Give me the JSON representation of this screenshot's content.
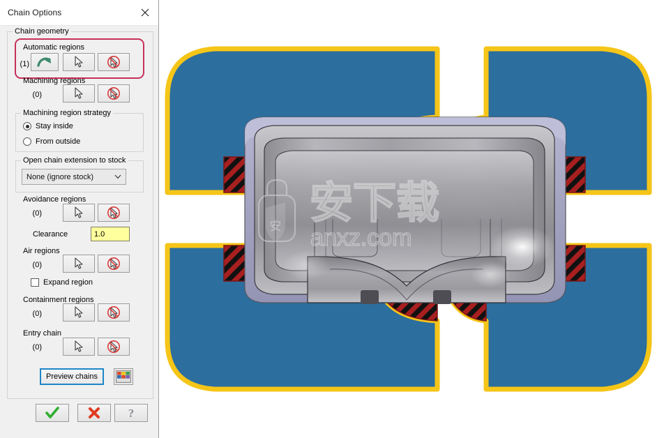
{
  "dialog": {
    "title": "Chain Options",
    "close_icon": "close-icon",
    "group_chain_geometry": "Chain geometry",
    "sections": {
      "automatic_regions": {
        "label": "Automatic regions",
        "count": "(1)"
      },
      "machining_regions": {
        "label": "Machining regions",
        "count": "(0)"
      },
      "avoidance_regions": {
        "label": "Avoidance regions",
        "count": "(0)"
      },
      "air_regions": {
        "label": "Air regions",
        "count": "(0)"
      },
      "containment_regions": {
        "label": "Containment regions",
        "count": "(0)"
      },
      "entry_chain": {
        "label": "Entry chain",
        "count": "(0)"
      }
    },
    "machining_region_strategy": {
      "label": "Machining region strategy",
      "options": [
        "Stay inside",
        "From outside"
      ],
      "selected": "Stay inside"
    },
    "open_chain_extension": {
      "label": "Open chain extension to stock",
      "value": "None (ignore stock)",
      "options": [
        "None (ignore stock)"
      ]
    },
    "clearance": {
      "label": "Clearance",
      "value": "1.0"
    },
    "expand_region": {
      "label": "Expand region",
      "checked": false
    },
    "preview_chains": "Preview chains",
    "palette_icon": "color-palette-icon",
    "buttons": {
      "ok": "ok-check-icon",
      "cancel": "cancel-x-icon",
      "help": "help-question-icon"
    },
    "icons": {
      "auto_arrow": "green-curved-arrow-icon",
      "select": "cursor-select-icon",
      "deselect": "cursor-deselect-icon"
    }
  },
  "viewport": {
    "watermark_cn": "安下载",
    "watermark_url": "anxz.com",
    "colors": {
      "stock_blue": "#2c6e9e",
      "chain_yellow": "#f5c518",
      "machining_red": "#a81f20",
      "hatch_black": "#111111",
      "model_gray": "#9a9a9e",
      "model_lavender": "#a9a9c4",
      "highlight": "#c7315a"
    }
  }
}
